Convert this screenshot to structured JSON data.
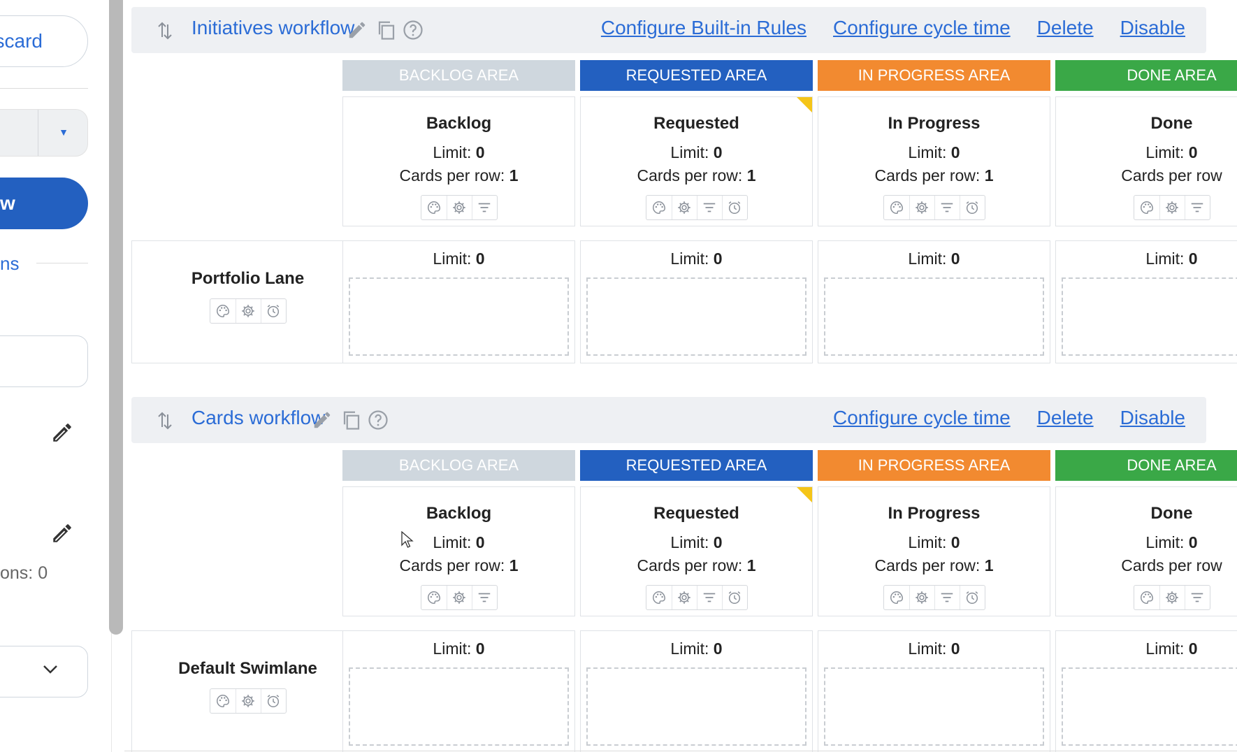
{
  "sidebar": {
    "discard_label": "scard",
    "primary_label": "w",
    "section_label": "ns",
    "count_label": "ons: 0"
  },
  "colors": {
    "link": "#2b6cd6",
    "backlog_area": "#cfd7de",
    "requested_area": "#2360c0",
    "in_progress_area": "#f28a30",
    "done_area": "#3aa847",
    "limit_flag": "#f5c518"
  },
  "workflows": [
    {
      "title": "Initiatives workflow",
      "actions": [
        "Configure Built-in Rules",
        "Configure cycle time",
        "Delete",
        "Disable"
      ],
      "areas": [
        "BACKLOG AREA",
        "REQUESTED AREA",
        "IN PROGRESS AREA",
        "DONE AREA"
      ],
      "columns": [
        {
          "name": "Backlog",
          "limit_label": "Limit:",
          "limit": "0",
          "cpr_label": "Cards per row:",
          "cpr": "1"
        },
        {
          "name": "Requested",
          "limit_label": "Limit:",
          "limit": "0",
          "cpr_label": "Cards per row:",
          "cpr": "1"
        },
        {
          "name": "In Progress",
          "limit_label": "Limit:",
          "limit": "0",
          "cpr_label": "Cards per row:",
          "cpr": "1"
        },
        {
          "name": "Done",
          "limit_label": "Limit:",
          "limit": "0",
          "cpr_label": "Cards per row",
          "cpr": ""
        }
      ],
      "lane": {
        "name": "Portfolio Lane"
      },
      "cells": [
        {
          "limit_label": "Limit:",
          "limit": "0"
        },
        {
          "limit_label": "Limit:",
          "limit": "0"
        },
        {
          "limit_label": "Limit:",
          "limit": "0"
        },
        {
          "limit_label": "Limit:",
          "limit": "0"
        }
      ]
    },
    {
      "title": "Cards workflow",
      "actions": [
        "Configure cycle time",
        "Delete",
        "Disable"
      ],
      "areas": [
        "BACKLOG AREA",
        "REQUESTED AREA",
        "IN PROGRESS AREA",
        "DONE AREA"
      ],
      "columns": [
        {
          "name": "Backlog",
          "limit_label": "Limit:",
          "limit": "0",
          "cpr_label": "Cards per row:",
          "cpr": "1"
        },
        {
          "name": "Requested",
          "limit_label": "Limit:",
          "limit": "0",
          "cpr_label": "Cards per row:",
          "cpr": "1"
        },
        {
          "name": "In Progress",
          "limit_label": "Limit:",
          "limit": "0",
          "cpr_label": "Cards per row:",
          "cpr": "1"
        },
        {
          "name": "Done",
          "limit_label": "Limit:",
          "limit": "0",
          "cpr_label": "Cards per row",
          "cpr": ""
        }
      ],
      "lane": {
        "name": "Default Swimlane"
      },
      "cells": [
        {
          "limit_label": "Limit:",
          "limit": "0"
        },
        {
          "limit_label": "Limit:",
          "limit": "0"
        },
        {
          "limit_label": "Limit:",
          "limit": "0"
        },
        {
          "limit_label": "Limit:",
          "limit": "0"
        }
      ]
    }
  ]
}
